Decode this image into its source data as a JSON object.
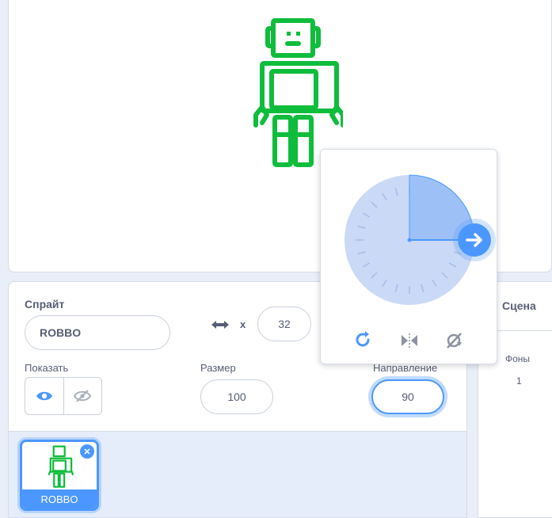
{
  "sprite_info": {
    "sprite_label": "Спрайт",
    "sprite_name": "ROBBO",
    "x_label": "x",
    "x_value": "32",
    "show_label": "Показать",
    "size_label": "Размер",
    "size_value": "100",
    "direction_label": "Направление",
    "direction_value": "90"
  },
  "direction_popover": {
    "direction_degrees": 90
  },
  "sprite_list": {
    "items": [
      {
        "name": "ROBBO",
        "selected": true
      }
    ]
  },
  "stage_panel": {
    "title": "Сцена",
    "backdrops_label": "Фоны",
    "backdrops_count": "1"
  },
  "colors": {
    "accent": "#4c97ff",
    "sprite_green": "#0fbd3c",
    "text": "#575e75"
  },
  "icons": [
    "arrows-horizontal-icon",
    "eye-icon",
    "eye-slash-icon",
    "rotate-all-around-icon",
    "left-right-icon",
    "dont-rotate-icon",
    "delete-icon",
    "arrow-right-icon"
  ]
}
